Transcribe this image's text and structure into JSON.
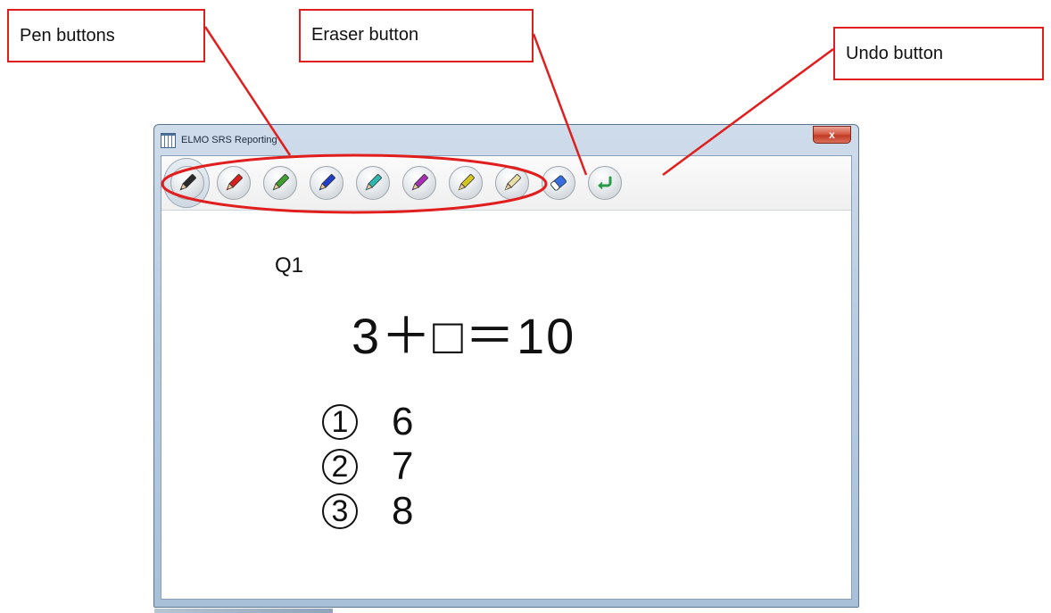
{
  "callouts": {
    "pen": "Pen buttons",
    "eraser": "Eraser button",
    "undo": "Undo button"
  },
  "window": {
    "title": "ELMO SRS Reporting",
    "close_glyph": "x"
  },
  "toolbar": {
    "tools": [
      {
        "name": "black-pen-button",
        "icon": "pencil-icon",
        "color": "#2a2a2a",
        "selected": true
      },
      {
        "name": "red-pen-button",
        "icon": "pencil-icon",
        "color": "#d8201c"
      },
      {
        "name": "green-pen-button",
        "icon": "pencil-icon",
        "color": "#3fa02f"
      },
      {
        "name": "blue-pen-button",
        "icon": "pencil-icon",
        "color": "#1f3fc8"
      },
      {
        "name": "cyan-pen-button",
        "icon": "pencil-icon",
        "color": "#2fb8b0"
      },
      {
        "name": "purple-pen-button",
        "icon": "pencil-icon",
        "color": "#a72fb3"
      },
      {
        "name": "yellow-pen-button",
        "icon": "pencil-icon",
        "color": "#d6c71e"
      },
      {
        "name": "light-yellow-pen-button",
        "icon": "pencil-icon",
        "color": "#e9dfa6"
      },
      {
        "name": "eraser-button",
        "icon": "eraser-icon",
        "color": "#3a6ee0"
      },
      {
        "name": "undo-button",
        "icon": "undo-arrow-icon",
        "color": "#2a9a4a"
      }
    ]
  },
  "content": {
    "question_label": "Q1",
    "equation": "3＋□＝10",
    "choices": [
      {
        "num": "1",
        "value": "6"
      },
      {
        "num": "2",
        "value": "7"
      },
      {
        "num": "3",
        "value": "8"
      }
    ]
  },
  "colors": {
    "callout_red": "#e01e1e"
  }
}
